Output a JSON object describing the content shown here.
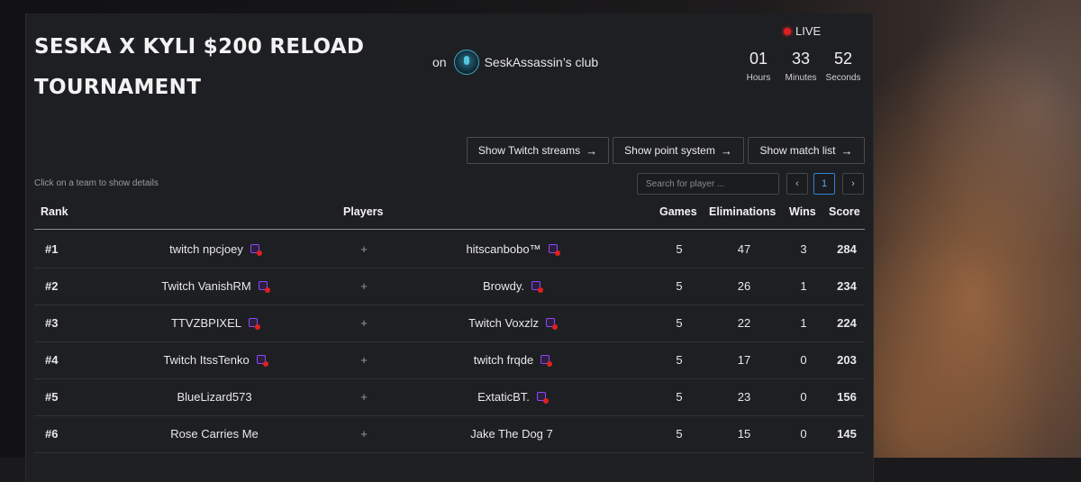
{
  "header": {
    "title": "SESKA X KYLI $200 RELOAD TOURNAMENT",
    "on_label": "on",
    "club_name": "SeskAssassin’s club",
    "live_label": "LIVE",
    "timer": [
      {
        "value": "01",
        "label": "Hours"
      },
      {
        "value": "33",
        "label": "Minutes"
      },
      {
        "value": "52",
        "label": "Seconds"
      }
    ]
  },
  "actions": [
    {
      "label": "Show Twitch streams",
      "icon": "arrow-right-icon"
    },
    {
      "label": "Show point system",
      "icon": "arrow-right-icon"
    },
    {
      "label": "Show match list",
      "icon": "arrow-right-icon"
    }
  ],
  "hint": "Click on a team to show details",
  "search": {
    "placeholder": "Search for player ..."
  },
  "pagination": {
    "prev": "‹",
    "page": "1",
    "next": "›"
  },
  "columns": {
    "rank": "Rank",
    "players": "Players",
    "games": "Games",
    "eliminations": "Eliminations",
    "wins": "Wins",
    "score": "Score"
  },
  "rows": [
    {
      "rank": "#1",
      "player1": "twitch npcjoey",
      "p1_live": true,
      "plus": "+",
      "player2": "hitscanbobo™",
      "p2_live": true,
      "games": "5",
      "eliminations": "47",
      "wins": "3",
      "score": "284"
    },
    {
      "rank": "#2",
      "player1": "Twitch VanishRM",
      "p1_live": true,
      "plus": "+",
      "player2": "Browdy.",
      "p2_live": true,
      "games": "5",
      "eliminations": "26",
      "wins": "1",
      "score": "234"
    },
    {
      "rank": "#3",
      "player1": "TTVZBPIXEL",
      "p1_live": true,
      "plus": "+",
      "player2": "Twitch Voxzlz",
      "p2_live": true,
      "games": "5",
      "eliminations": "22",
      "wins": "1",
      "score": "224"
    },
    {
      "rank": "#4",
      "player1": "Twitch ItssTenko",
      "p1_live": true,
      "plus": "+",
      "player2": "twitch frqde",
      "p2_live": true,
      "games": "5",
      "eliminations": "17",
      "wins": "0",
      "score": "203"
    },
    {
      "rank": "#5",
      "player1": "BlueLizard573",
      "p1_live": false,
      "plus": "+",
      "player2": "ExtaticBT.",
      "p2_live": true,
      "games": "5",
      "eliminations": "23",
      "wins": "0",
      "score": "156"
    },
    {
      "rank": "#6",
      "player1": "Rose Carries Me",
      "p1_live": false,
      "plus": "+",
      "player2": "Jake The Dog 7",
      "p2_live": false,
      "games": "5",
      "eliminations": "15",
      "wins": "0",
      "score": "145"
    }
  ],
  "colors": {
    "twitch": "#9146ff",
    "live_dot": "#e01e1e",
    "active_page": "#2d7fd6"
  }
}
